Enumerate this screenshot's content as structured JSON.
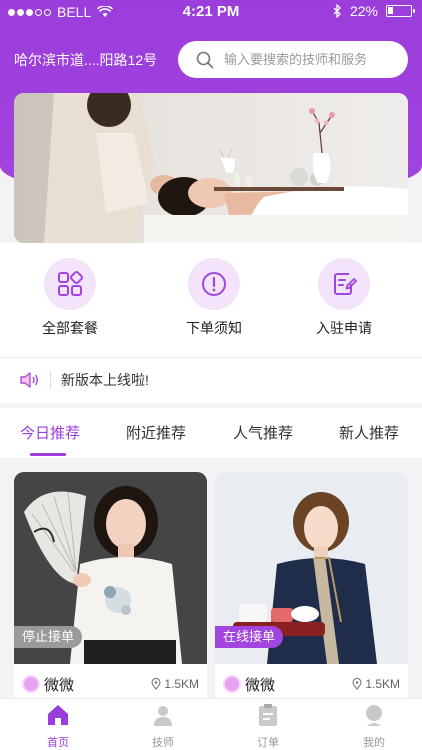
{
  "status_bar": {
    "carrier": "BELL",
    "time": "4:21 PM",
    "battery": "22%",
    "battery_level": 0.22
  },
  "header": {
    "location": "哈尔滨市道....阳路12号",
    "search_placeholder": "输入要搜索的技师和服务"
  },
  "features": [
    {
      "label": "全部套餐",
      "icon": "grid-icon"
    },
    {
      "label": "下单须知",
      "icon": "alert-icon"
    },
    {
      "label": "入驻申请",
      "icon": "edit-document-icon"
    }
  ],
  "notice": {
    "text": "新版本上线啦!",
    "icon": "speaker-icon"
  },
  "tabs": [
    {
      "label": "今日推荐",
      "active": true
    },
    {
      "label": "附近推荐",
      "active": false
    },
    {
      "label": "人气推荐",
      "active": false
    },
    {
      "label": "新人推荐",
      "active": false
    }
  ],
  "cards": [
    {
      "name": "微微",
      "distance": "1.5KM",
      "status": "停止接单",
      "status_color": "#9a9a9a"
    },
    {
      "name": "微微",
      "distance": "1.5KM",
      "status": "在线接单",
      "status_color": "#a244e0"
    }
  ],
  "tabbar": [
    {
      "label": "首页",
      "icon": "home-icon",
      "active": true
    },
    {
      "label": "技师",
      "icon": "technician-icon",
      "active": false
    },
    {
      "label": "订单",
      "icon": "order-icon",
      "active": false
    },
    {
      "label": "我的",
      "icon": "profile-icon",
      "active": false
    }
  ],
  "colors": {
    "accent": "#9b3ddb",
    "feature_bg": "#f4e4fb"
  }
}
